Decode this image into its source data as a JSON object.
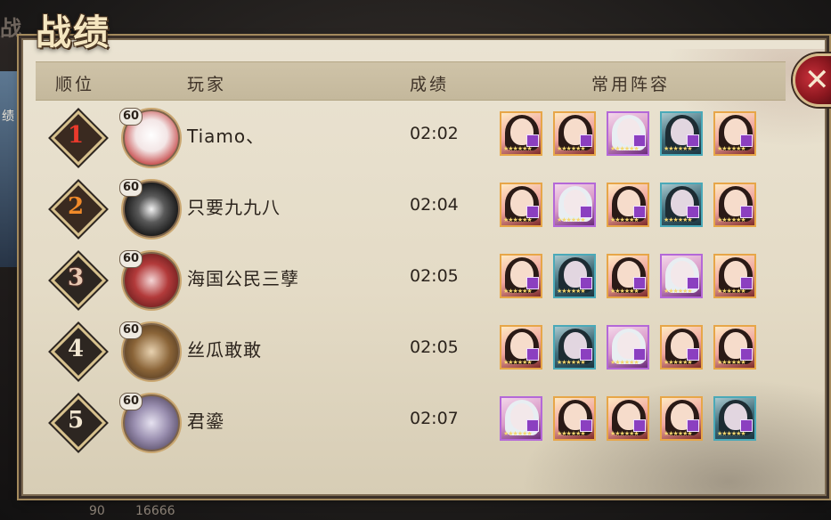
{
  "title": "战绩",
  "header": {
    "rank": "顺位",
    "player": "玩家",
    "score": "成绩",
    "lineup": "常用阵容"
  },
  "close_icon": "close-icon",
  "background": {
    "left_tab_label": "绩",
    "top_ghost": "战",
    "bottom_left": "90",
    "bottom_mid": "16666"
  },
  "players": [
    {
      "rank": "1",
      "level": "60",
      "name": "Tiamo、",
      "score": "02:02",
      "lineup": [
        "sp",
        "sp",
        "ssr",
        "teal",
        "sp"
      ]
    },
    {
      "rank": "2",
      "level": "60",
      "name": "只要九九八",
      "score": "02:04",
      "lineup": [
        "sp",
        "ssr",
        "sp",
        "teal",
        "sp"
      ]
    },
    {
      "rank": "3",
      "level": "60",
      "name": "海国公民三孽",
      "score": "02:05",
      "lineup": [
        "sp",
        "teal",
        "sp",
        "ssr",
        "sp"
      ]
    },
    {
      "rank": "4",
      "level": "60",
      "name": "丝瓜敢敢",
      "score": "02:05",
      "lineup": [
        "sp",
        "teal",
        "ssr",
        "sp",
        "sp"
      ]
    },
    {
      "rank": "5",
      "level": "60",
      "name": "君鎏",
      "score": "02:07",
      "lineup": [
        "ssr",
        "sp",
        "sp",
        "sp",
        "teal"
      ]
    }
  ],
  "colors": {
    "panel_bg": "#e4dbc6",
    "header_bg": "#c9bda1",
    "rank1": "#ea3a2c",
    "rank2": "#f08a2a",
    "close_red": "#a51e27"
  }
}
